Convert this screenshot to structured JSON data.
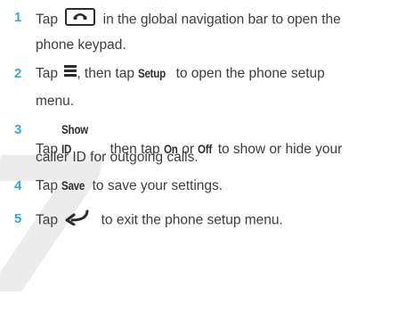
{
  "watermark": "7",
  "steps": [
    {
      "number": "1",
      "pre": "Tap",
      "icon": "phone-icon",
      "post": "in the global navigation bar to open the",
      "line2": "phone keypad."
    },
    {
      "number": "2",
      "pre": "Tap",
      "icon": "menu-icon",
      "post": ", then tap",
      "keyword": "Setup",
      "post2": "to open the phone setup",
      "line2": "menu."
    },
    {
      "number": "3",
      "pre": "Tap",
      "keyword": "Show ID",
      "mid": "then tap",
      "keyword2": "On",
      "mid2": "or",
      "keyword3": "Off",
      "post": "to show or hide your",
      "line2": "caller ID for outgoing calls."
    },
    {
      "number": "4",
      "pre": "Tap",
      "keyword": "Save",
      "post": "to save your settings."
    },
    {
      "number": "5",
      "pre": "Tap",
      "icon": "back-icon",
      "post": "to exit the phone setup menu."
    }
  ]
}
